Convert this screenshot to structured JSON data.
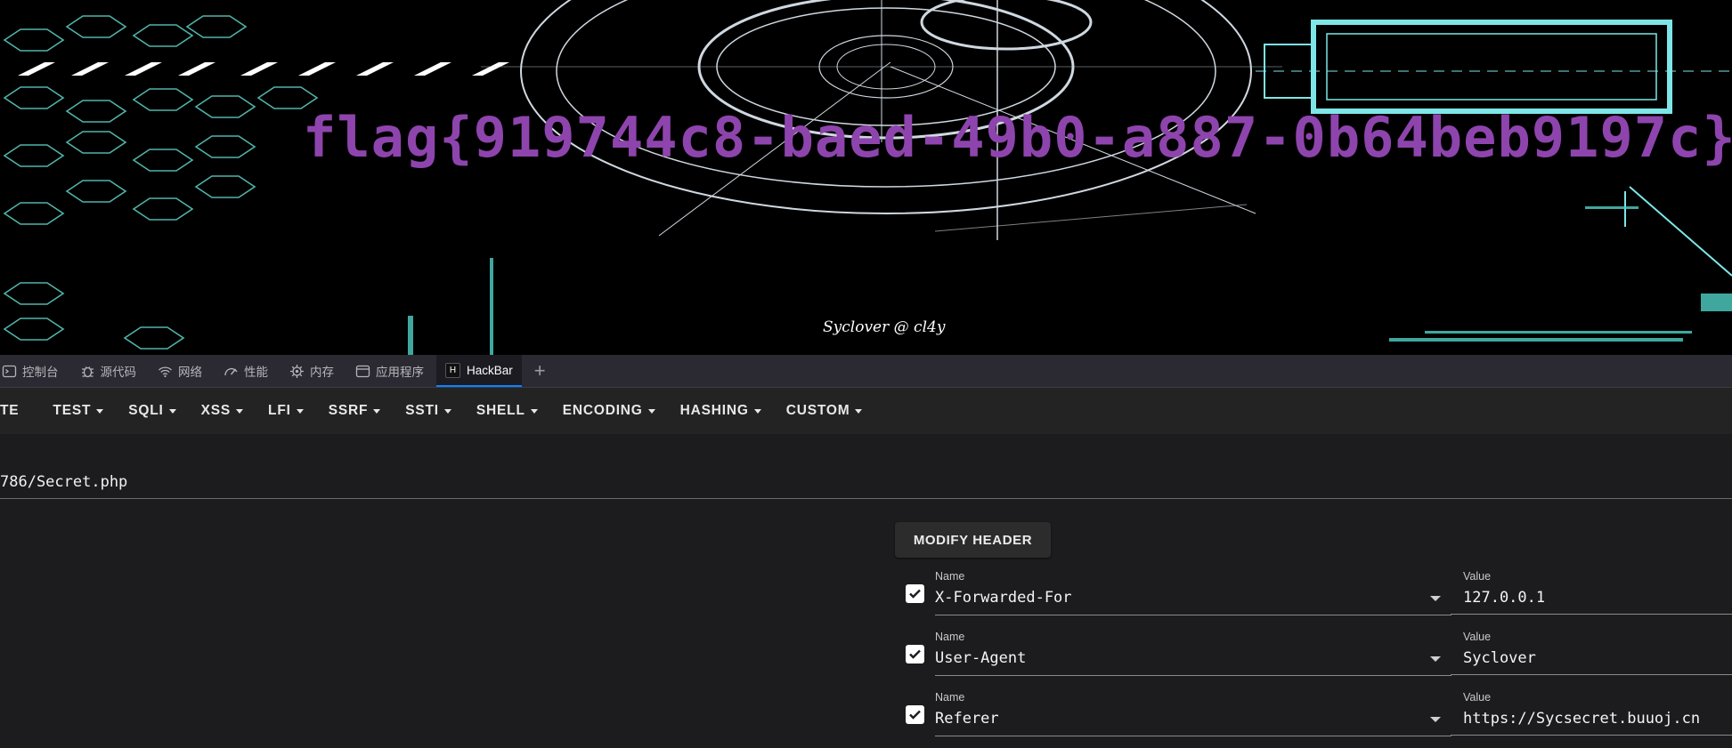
{
  "page": {
    "flag_text": "flag{919744c8-baed-49b0-a887-0b64beb9197c}",
    "credit": "Syclover @ cl4y"
  },
  "devtools": {
    "tabs": [
      {
        "label": "控制台",
        "icon": "console-icon"
      },
      {
        "label": "源代码",
        "icon": "debugger-icon"
      },
      {
        "label": "网络",
        "icon": "network-icon"
      },
      {
        "label": "性能",
        "icon": "performance-icon"
      },
      {
        "label": "内存",
        "icon": "memory-icon"
      },
      {
        "label": "应用程序",
        "icon": "application-icon"
      },
      {
        "label": "HackBar",
        "icon": "hackbar-icon",
        "active": true
      }
    ],
    "add_tab": "+"
  },
  "hackbar": {
    "menu": [
      {
        "label": "TE"
      },
      {
        "label": "TEST"
      },
      {
        "label": "SQLI"
      },
      {
        "label": "XSS"
      },
      {
        "label": "LFI"
      },
      {
        "label": "SSRF"
      },
      {
        "label": "SSTI"
      },
      {
        "label": "SHELL"
      },
      {
        "label": "ENCODING"
      },
      {
        "label": "HASHING"
      },
      {
        "label": "CUSTOM"
      }
    ],
    "url": "786/Secret.php",
    "modify_header_label": "MODIFY HEADER",
    "headers": [
      {
        "name_label": "Name",
        "name": "X-Forwarded-For",
        "value_label": "Value",
        "value": "127.0.0.1",
        "checked": true
      },
      {
        "name_label": "Name",
        "name": "User-Agent",
        "value_label": "Value",
        "value": "Syclover",
        "checked": true
      },
      {
        "name_label": "Name",
        "name": "Referer",
        "value_label": "Value",
        "value": "https://Sycsecret.buuoj.cn",
        "checked": true
      }
    ]
  },
  "colors": {
    "flag": "#8e44ad",
    "accent": "#0a84ff",
    "decor_cyan": "#4fd1c5"
  }
}
